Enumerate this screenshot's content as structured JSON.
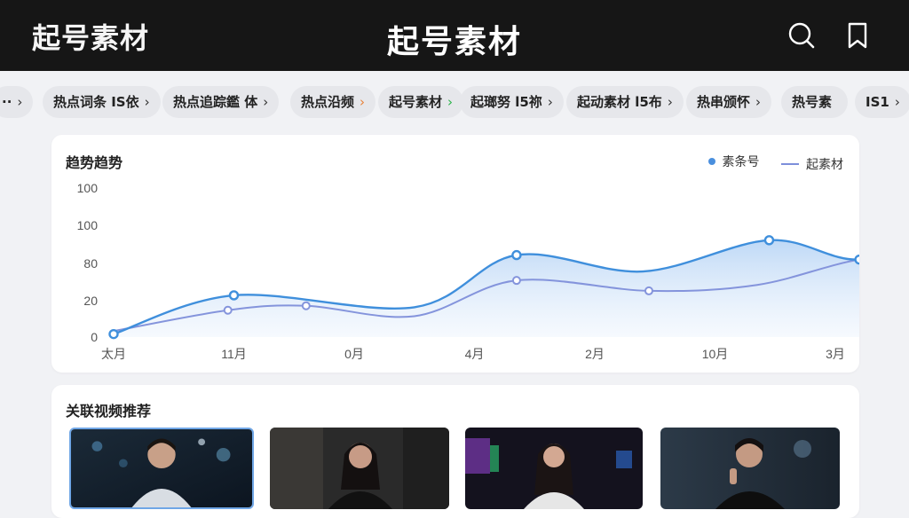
{
  "header": {
    "brand": "起号素材",
    "title": "起号素材",
    "icons": [
      "search-icon",
      "bookmark-icon"
    ]
  },
  "tags": [
    {
      "label": "··",
      "chev": "›"
    },
    {
      "label": "热点词条 IS依",
      "chev": "›"
    },
    {
      "label": "热点追踪鑑 体",
      "chev": "›"
    },
    {
      "label": "热点沿频",
      "chev": "›"
    },
    {
      "label": "起号素材",
      "chev": "›"
    },
    {
      "label": "起瑯努 l5祢",
      "chev": "›"
    },
    {
      "label": "起动素材 l5布",
      "chev": "›"
    },
    {
      "label": "热串颁怀",
      "chev": "›"
    },
    {
      "label": "热号素",
      "chev": ""
    },
    {
      "label": "IS1",
      "chev": "›"
    }
  ],
  "chart_card": {
    "title": "趋势趋势",
    "legend": [
      {
        "label": "素条号",
        "kind": "dot"
      },
      {
        "label": "起素材",
        "kind": "line"
      }
    ]
  },
  "chart_data": {
    "type": "area",
    "title": "趋势趋势",
    "categories": [
      "太月",
      "11月",
      "0月",
      "4月",
      "2月",
      "10月",
      "3月"
    ],
    "y_ticks": [
      "100",
      "100",
      "80",
      "20",
      "0"
    ],
    "ylim": [
      0,
      100
    ],
    "grid": false,
    "legend_position": "top-right",
    "series": [
      {
        "name": "素条号",
        "color": "#3f8fdc",
        "points": [
          [
            0,
            2
          ],
          [
            1,
            28
          ],
          [
            2.5,
            20
          ],
          [
            3.35,
            55
          ],
          [
            4.4,
            44
          ],
          [
            5.45,
            65
          ],
          [
            6.2,
            52
          ],
          [
            7,
            70
          ]
        ]
      },
      {
        "name": "起素材",
        "color": "#8494dc",
        "points": [
          [
            0,
            4
          ],
          [
            0.95,
            18
          ],
          [
            1.6,
            21
          ],
          [
            2.5,
            14
          ],
          [
            3.35,
            38
          ],
          [
            4.45,
            31
          ],
          [
            5.35,
            35
          ],
          [
            6.2,
            52
          ],
          [
            7,
            57
          ]
        ]
      }
    ]
  },
  "recommend": {
    "title": "关联视频推荐",
    "videos": [
      {
        "name": "video-1",
        "selected": true
      },
      {
        "name": "video-2",
        "selected": false
      },
      {
        "name": "video-3",
        "selected": false
      },
      {
        "name": "video-4",
        "selected": false
      }
    ]
  },
  "colors": {
    "topbar": "#161616",
    "accent": "#3f8fdc",
    "series2": "#8494dc",
    "background": "#f1f2f5"
  }
}
